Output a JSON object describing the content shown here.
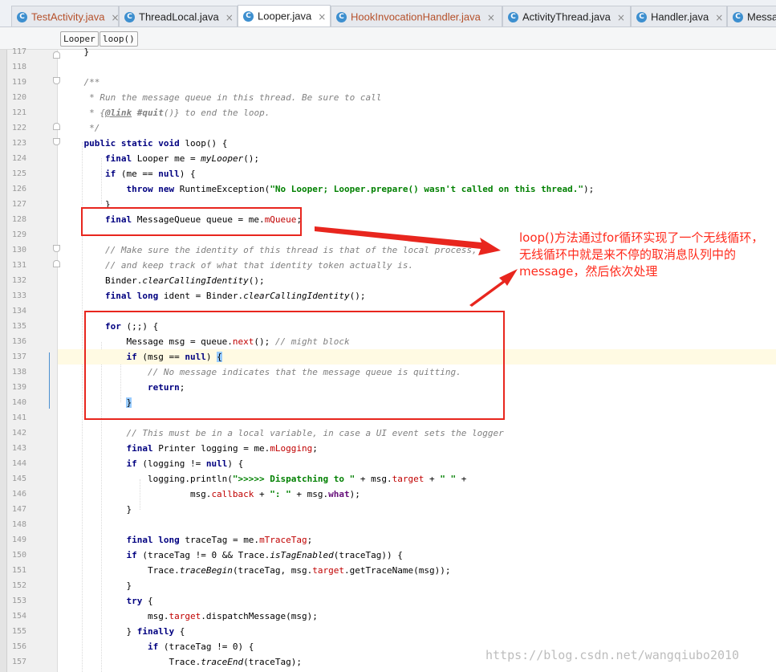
{
  "tabs": [
    {
      "name": "TestActivity.java",
      "active": false,
      "modified": true
    },
    {
      "name": "ThreadLocal.java",
      "active": false,
      "modified": false
    },
    {
      "name": "Looper.java",
      "active": true,
      "modified": false
    },
    {
      "name": "HookInvocationHandler.java",
      "active": false,
      "modified": true
    },
    {
      "name": "ActivityThread.java",
      "active": false,
      "modified": false
    },
    {
      "name": "Handler.java",
      "active": false,
      "modified": false
    },
    {
      "name": "Messa",
      "active": false,
      "modified": false
    }
  ],
  "tab_close_glyph": "×",
  "breadcrumb": [
    "Looper",
    "loop()"
  ],
  "editor": {
    "line_numbers": [
      "117",
      "118",
      "119",
      "120",
      "121",
      "122",
      "123",
      "124",
      "125",
      "126",
      "127",
      "128",
      "129",
      "130",
      "131",
      "132",
      "133",
      "134",
      "135",
      "136",
      "137",
      "138",
      "139",
      "140",
      "141",
      "142",
      "143",
      "144",
      "145",
      "146",
      "147",
      "148",
      "149",
      "150",
      "151",
      "152",
      "153",
      "154",
      "155",
      "156",
      "157"
    ],
    "current_line": "137"
  },
  "annotation": {
    "text": "loop()方法通过for循环实现了一个无线循环，无线循环中就是来不停的取消息队列中的message，然后依次处理",
    "color": "#ff2a1c"
  },
  "watermark": "https://blog.csdn.net/wangqiubo2010",
  "colors": {
    "keyword": "#000080",
    "comment": "#808080",
    "string": "#008000",
    "field": "#660e7a",
    "annotation_red": "#e8261e"
  }
}
